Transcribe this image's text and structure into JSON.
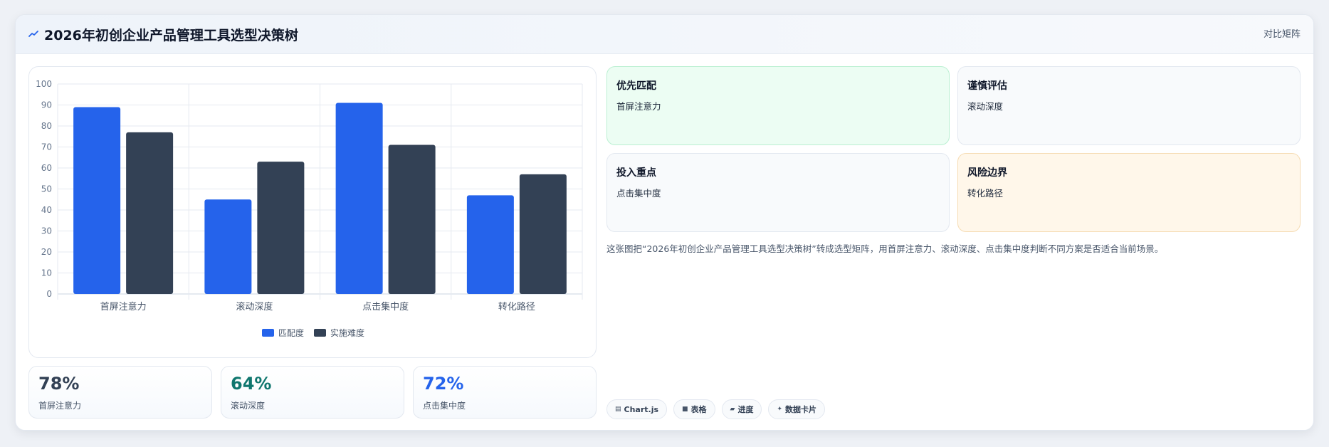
{
  "header": {
    "title": "2026年初创企业产品管理工具选型决策树",
    "action_label": "对比矩阵"
  },
  "chart_data": {
    "type": "bar",
    "categories": [
      "首屏注意力",
      "滚动深度",
      "点击集中度",
      "转化路径"
    ],
    "series": [
      {
        "name": "匹配度",
        "color": "#2563eb",
        "values": [
          89,
          45,
          91,
          47
        ]
      },
      {
        "name": "实施难度",
        "color": "#334155",
        "values": [
          77,
          63,
          71,
          57
        ]
      }
    ],
    "ylim": [
      0,
      100
    ],
    "yticks": [
      "0",
      "10",
      "20",
      "30",
      "40",
      "50",
      "60",
      "70",
      "80",
      "90",
      "100"
    ],
    "grid": true,
    "legend": "bottom"
  },
  "stats": [
    {
      "value": "78%",
      "label": "首屏注意力",
      "color": "#334155"
    },
    {
      "value": "64%",
      "label": "滚动深度",
      "color": "#0f766e"
    },
    {
      "value": "72%",
      "label": "点击集中度",
      "color": "#2563eb"
    }
  ],
  "matrix": [
    {
      "title": "优先匹配",
      "body": "首屏注意力",
      "bg": "#ecfdf3",
      "border": "#bbf0d2"
    },
    {
      "title": "谨慎评估",
      "body": "滚动深度",
      "bg": "#f8fafc",
      "border": "#e3e8f0"
    },
    {
      "title": "投入重点",
      "body": "点击集中度",
      "bg": "#f8fafc",
      "border": "#e3e8f0"
    },
    {
      "title": "风险边界",
      "body": "转化路径",
      "bg": "#fff7ea",
      "border": "#f6dcb4"
    }
  ],
  "description": "这张图把“2026年初创企业产品管理工具选型决策树”转成选型矩阵，用首屏注意力、滚动深度、点击集中度判断不同方案是否适合当前场景。",
  "tags": [
    {
      "icon": "table-icon",
      "label": "Chart.js"
    },
    {
      "icon": "grid-icon",
      "label": "表格"
    },
    {
      "icon": "progress-icon",
      "label": "进度"
    },
    {
      "icon": "sparkle-icon",
      "label": "数据卡片"
    }
  ]
}
